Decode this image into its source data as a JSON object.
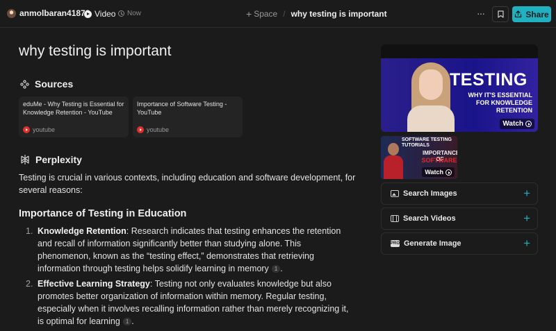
{
  "topbar": {
    "username": "anmolbaran41878",
    "type_label": "Video",
    "time_label": "Now",
    "space_label": "Space",
    "breadcrumb_sep": "/",
    "thread_title": "why testing is important",
    "more_label": "···",
    "share_label": "Share"
  },
  "main": {
    "title": "why testing is important",
    "sources_heading": "Sources",
    "sources": [
      {
        "title": "eduMe - Why Testing is Essential for Knowledge Retention - YouTube",
        "site": "youtube"
      },
      {
        "title": "Importance of Software Testing - YouTube",
        "site": "youtube"
      }
    ],
    "answer_heading": "Perplexity",
    "intro": "Testing is crucial in various contexts, including education and software development, for several reasons:",
    "subheading": "Importance of Testing in Education",
    "list": [
      {
        "num": "1.",
        "term": "Knowledge Retention",
        "text": ": Research indicates that testing enhances the retention and recall of information significantly better than studying alone. This phenomenon, known as the “testing effect,” demonstrates that retrieving information through testing helps solidify learning in memory",
        "cite": "1",
        "end": "."
      },
      {
        "num": "2.",
        "term": "Effective Learning Strategy",
        "text": ": Testing not only evaluates knowledge but also promotes better organization of information within memory. Regular testing, especially when it involves recalling information rather than merely recognizing it, is optimal for learning",
        "cite": "1",
        "end": "."
      }
    ]
  },
  "sidebar": {
    "video_main": {
      "headline": "TESTING",
      "sub": "WHY IT'S ESSENTIAL FOR KNOWLEDGE RETENTION",
      "watch": "Watch"
    },
    "video_thumb": {
      "top_text": "SOFTWARE TESTING TUTORIALS",
      "mid_text": "IMPORTANCE OF",
      "mid_text2": "SOFTWARE",
      "watch": "Watch"
    },
    "actions": [
      {
        "label": "Search Images",
        "icon": "image-icon"
      },
      {
        "label": "Search Videos",
        "icon": "video-icon"
      },
      {
        "label": "Generate Image",
        "icon": "pro-icon",
        "badge": "PRO"
      }
    ]
  },
  "colors": {
    "accent": "#20b0c0",
    "background": "#1b1b1b",
    "card": "#242424",
    "youtube": "#e0312c"
  }
}
